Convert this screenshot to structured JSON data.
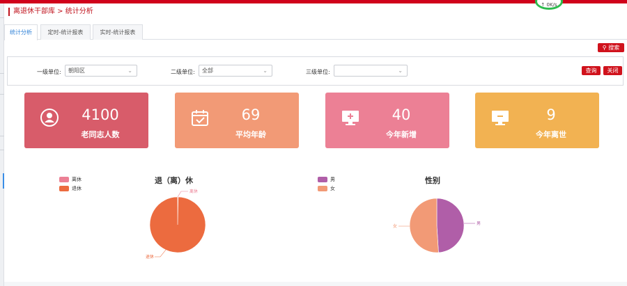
{
  "speed_badge": "↑ 0K/s",
  "breadcrumb": "离退休干部库 > 统计分析",
  "tabs": [
    {
      "label": "统计分析",
      "active": true
    },
    {
      "label": "定时-统计报表",
      "active": false
    },
    {
      "label": "实时-统计报表",
      "active": false
    }
  ],
  "search_button": "搜索",
  "filters": [
    {
      "label": "一级单位:",
      "value": "朝阳区"
    },
    {
      "label": "二级单位:",
      "value": "全部"
    },
    {
      "label": "三级单位:",
      "value": ""
    }
  ],
  "query_button": "查询",
  "close_button": "关闭",
  "cards": [
    {
      "value": "4100",
      "label": "老同志人数",
      "color": "#d85c6a",
      "icon": "user-icon"
    },
    {
      "value": "69",
      "label": "平均年龄",
      "color": "#f29a76",
      "icon": "calendar-icon"
    },
    {
      "value": "40",
      "label": "今年新增",
      "color": "#ec8095",
      "icon": "monitor-plus-icon"
    },
    {
      "value": "9",
      "label": "今年离世",
      "color": "#f2b252",
      "icon": "monitor-minus-icon"
    }
  ],
  "chart_data": [
    {
      "type": "pie",
      "title": "退（离）休",
      "legend": "top-left",
      "slices": [
        {
          "name": "离休",
          "value": 0.3,
          "color": "#ec8095"
        },
        {
          "name": "退休",
          "value": 99.7,
          "color": "#ec6b3f"
        }
      ]
    },
    {
      "type": "pie",
      "title": "性别",
      "legend": "top-left",
      "slices": [
        {
          "name": "男",
          "value": 49,
          "color": "#b05ea8"
        },
        {
          "name": "女",
          "value": 51,
          "color": "#f29a76"
        }
      ]
    }
  ]
}
